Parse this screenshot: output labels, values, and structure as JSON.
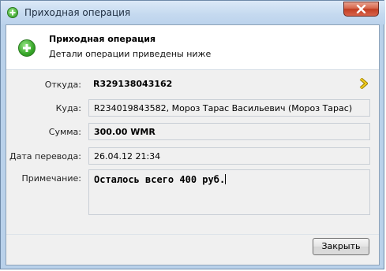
{
  "window": {
    "title": "Приходная операция"
  },
  "header": {
    "title": "Приходная операция",
    "subtitle": "Детали операции приведены ниже"
  },
  "fields": {
    "from_label": "Откуда:",
    "from_value": "R329138043162",
    "to_label": "Куда:",
    "to_value": "R234019843582, Мороз Тарас Васильевич (Мороз Тарас)",
    "amount_label": "Сумма:",
    "amount_value": "300.00 WMR",
    "date_label": "Дата перевода:",
    "date_value": "26.04.12 21:34",
    "note_label": "Примечание:",
    "note_value": "Осталось всего 400 руб."
  },
  "footer": {
    "close_label": "Закрыть"
  },
  "icons": {
    "title_icon": "plus-circle-icon",
    "header_icon": "plus-circle-icon",
    "from_arrow": "chevron-right-icon",
    "window_close": "close-icon"
  },
  "colors": {
    "accent_green": "#36a628",
    "arrow_yellow": "#e8c21a",
    "close_red": "#c23e22"
  }
}
